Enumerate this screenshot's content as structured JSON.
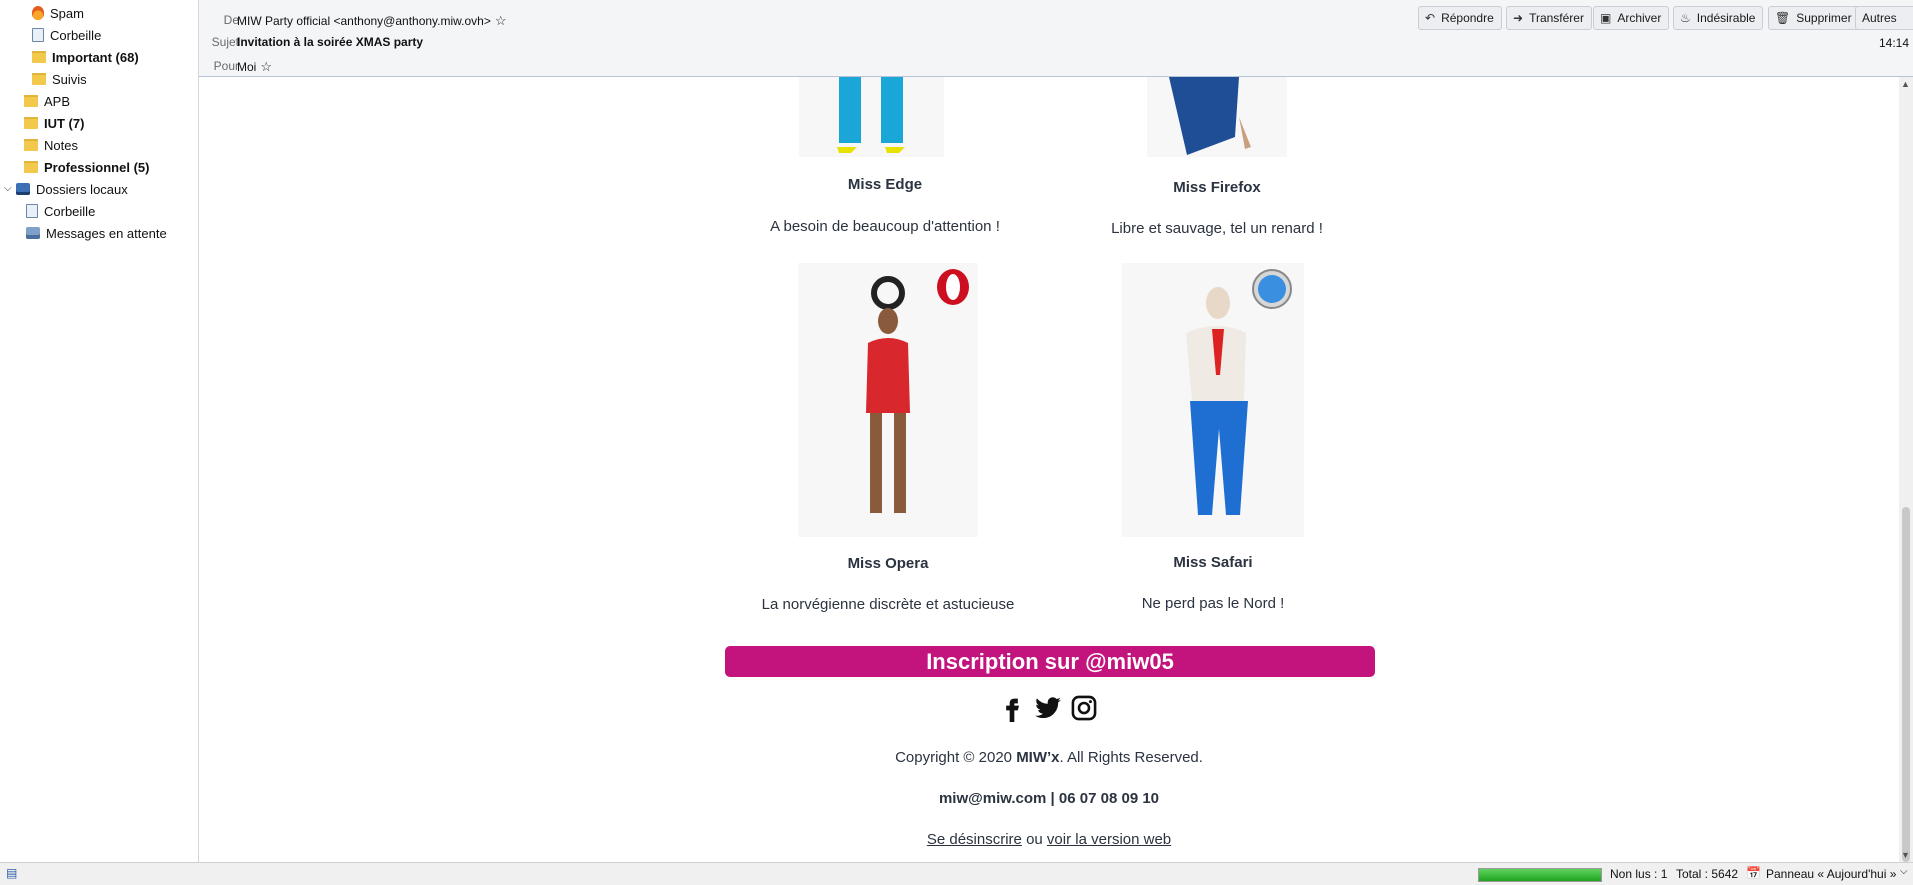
{
  "sidebar": {
    "items": [
      {
        "label": "Spam",
        "icon": "fire-icon",
        "bold": false
      },
      {
        "label": "Corbeille",
        "icon": "trash-icon",
        "bold": false
      },
      {
        "label": "Important (68)",
        "icon": "folder-icon",
        "bold": true
      },
      {
        "label": "Suivis",
        "icon": "folder-icon",
        "bold": false
      },
      {
        "label": "APB",
        "icon": "folder-icon",
        "bold": false
      },
      {
        "label": "IUT (7)",
        "icon": "folder-icon",
        "bold": true
      },
      {
        "label": "Notes",
        "icon": "folder-icon",
        "bold": false
      },
      {
        "label": "Professionnel (5)",
        "icon": "folder-icon",
        "bold": true
      },
      {
        "label": "Dossiers locaux",
        "icon": "local-drive-icon",
        "bold": false
      },
      {
        "label": "Corbeille",
        "icon": "trash-icon",
        "bold": false
      },
      {
        "label": "Messages en attente",
        "icon": "outbox-icon",
        "bold": false
      }
    ]
  },
  "header": {
    "from_label": "De",
    "from_value": "MIW Party official <anthony@anthony.miw.ovh>",
    "subject_label": "Sujet",
    "subject_value": "Invitation à la soirée XMAS party",
    "to_label": "Pour",
    "to_value": "Moi",
    "time": "14:14",
    "toolbar": {
      "reply": "Répondre",
      "forward": "Transférer",
      "archive": "Archiver",
      "junk": "Indésirable",
      "delete": "Supprimer",
      "other": "Autres"
    }
  },
  "email": {
    "cards": [
      {
        "title": "Miss Edge",
        "desc": "A besoin de beaucoup d'attention !"
      },
      {
        "title": "Miss Firefox",
        "desc": "Libre et sauvage, tel un renard !"
      },
      {
        "title": "Miss Opera",
        "desc": "La norvégienne discrète et astucieuse"
      },
      {
        "title": "Miss Safari",
        "desc": "Ne perd pas le Nord !"
      }
    ],
    "cta": "Inscription sur @miw05",
    "social": [
      "facebook-icon",
      "twitter-icon",
      "instagram-icon"
    ],
    "copyright_prefix": "Copyright © 2020 ",
    "copyright_brand": "MIW’x",
    "copyright_suffix": ". All Rights Reserved.",
    "contact": "miw@miw.com | 06 07 08 09 10",
    "unsubscribe": "Se désinscrire",
    "or": "ou",
    "web_version": "voir la version web"
  },
  "statusbar": {
    "progress": 1.0,
    "unread": "Non lus : 1",
    "total": "Total : 5642",
    "panel": "Panneau « Aujourd'hui »"
  },
  "colors": {
    "accent": "#c3137d",
    "text": "#2b3340",
    "header_bg": "#f4f5f7"
  }
}
